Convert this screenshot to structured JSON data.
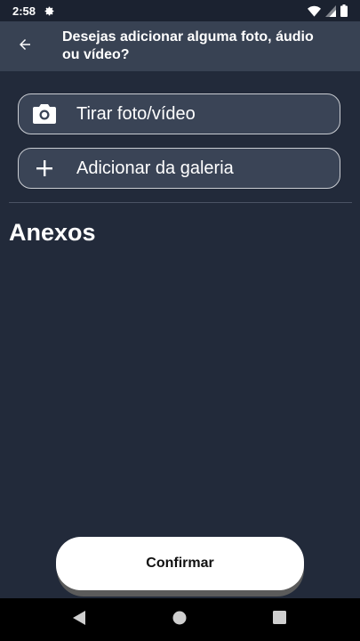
{
  "status_bar": {
    "time": "2:58",
    "icons": [
      "gear-icon",
      "wifi-icon",
      "signal-icon",
      "battery-icon"
    ]
  },
  "app_bar": {
    "back_icon": "arrow-left-icon",
    "title": "Desejas adicionar alguma foto, áudio ou vídeo?"
  },
  "actions": {
    "camera": {
      "icon": "camera-icon",
      "label": "Tirar foto/vídeo"
    },
    "gallery": {
      "icon": "plus-icon",
      "label": "Adicionar da galeria"
    }
  },
  "attachments": {
    "title": "Anexos"
  },
  "confirm": {
    "label": "Confirmar"
  },
  "nav_bar": {
    "icons": [
      "back-triangle-icon",
      "home-circle-icon",
      "recents-square-icon"
    ]
  },
  "colors": {
    "background": "#222a3a",
    "app_bar": "#384253",
    "button_fill": "#3a4456",
    "button_border": "#c9ccd2",
    "confirm": "#ffffff"
  }
}
